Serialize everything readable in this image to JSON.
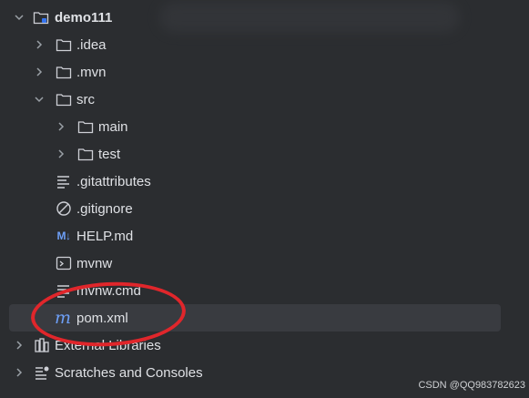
{
  "project_tree": {
    "root": {
      "label": "demo111"
    },
    "items": [
      {
        "label": ".idea"
      },
      {
        "label": ".mvn"
      },
      {
        "label": "src"
      },
      {
        "label": "main"
      },
      {
        "label": "test"
      },
      {
        "label": ".gitattributes"
      },
      {
        "label": ".gitignore"
      },
      {
        "label": "HELP.md"
      },
      {
        "label": "mvnw"
      },
      {
        "label": "mvnw.cmd"
      },
      {
        "label": "pom.xml"
      }
    ],
    "external_libraries": {
      "label": "External Libraries"
    },
    "scratches": {
      "label": "Scratches and Consoles"
    }
  },
  "icons": {
    "md_badge": "M↓",
    "pom_icon_glyph": "m"
  },
  "annotation": {
    "color": "#e0262b"
  },
  "watermark": {
    "text": "CSDN @QQ983782623"
  }
}
